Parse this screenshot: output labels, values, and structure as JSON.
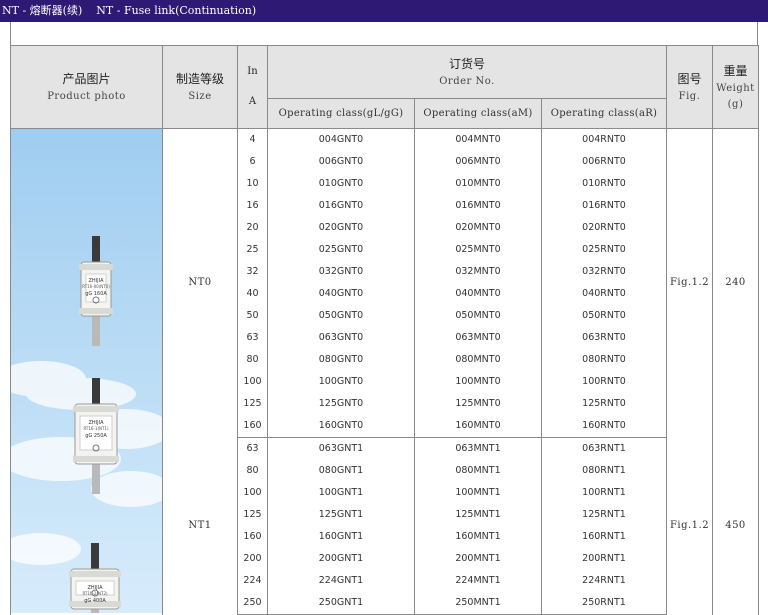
{
  "title": {
    "zh": "NT - 熔断器(续)",
    "en": "NT - Fuse link(Continuation)"
  },
  "header": {
    "photo_zh": "产品图片",
    "photo_en": "Product photo",
    "size_zh": "制造等级",
    "size_en": "Size",
    "in_top": "In",
    "in_bottom": "A",
    "order_zh": "订货号",
    "order_en": "Order No.",
    "op_gl": "Operating class(gL/gG)",
    "op_am": "Operating class(aM)",
    "op_ar": "Operating class(aR)",
    "fig_zh": "图号",
    "fig_en": "Fig.",
    "weight_zh": "重量",
    "weight_en": "Weight",
    "weight_unit": "(g)"
  },
  "groups": [
    {
      "size": "NT0",
      "fig": "Fig.1.2",
      "weight": "240",
      "rows": [
        {
          "in": "4",
          "gl": "004GNT0",
          "am": "004MNT0",
          "ar": "004RNT0"
        },
        {
          "in": "6",
          "gl": "006GNT0",
          "am": "006MNT0",
          "ar": "006RNT0"
        },
        {
          "in": "10",
          "gl": "010GNT0",
          "am": "010MNT0",
          "ar": "010RNT0"
        },
        {
          "in": "16",
          "gl": "016GNT0",
          "am": "016MNT0",
          "ar": "016RNT0"
        },
        {
          "in": "20",
          "gl": "020GNT0",
          "am": "020MNT0",
          "ar": "020RNT0"
        },
        {
          "in": "25",
          "gl": "025GNT0",
          "am": "025MNT0",
          "ar": "025RNT0"
        },
        {
          "in": "32",
          "gl": "032GNT0",
          "am": "032MNT0",
          "ar": "032RNT0"
        },
        {
          "in": "40",
          "gl": "040GNT0",
          "am": "040MNT0",
          "ar": "040RNT0"
        },
        {
          "in": "50",
          "gl": "050GNT0",
          "am": "050MNT0",
          "ar": "050RNT0"
        },
        {
          "in": "63",
          "gl": "063GNT0",
          "am": "063MNT0",
          "ar": "063RNT0"
        },
        {
          "in": "80",
          "gl": "080GNT0",
          "am": "080MNT0",
          "ar": "080RNT0"
        },
        {
          "in": "100",
          "gl": "100GNT0",
          "am": "100MNT0",
          "ar": "100RNT0"
        },
        {
          "in": "125",
          "gl": "125GNT0",
          "am": "125MNT0",
          "ar": "125RNT0"
        },
        {
          "in": "160",
          "gl": "160GNT0",
          "am": "160MNT0",
          "ar": "160RNT0"
        }
      ]
    },
    {
      "size": "NT1",
      "fig": "Fig.1.2",
      "weight": "450",
      "rows": [
        {
          "in": "63",
          "gl": "063GNT1",
          "am": "063MNT1",
          "ar": "063RNT1"
        },
        {
          "in": "80",
          "gl": "080GNT1",
          "am": "080MNT1",
          "ar": "080RNT1"
        },
        {
          "in": "100",
          "gl": "100GNT1",
          "am": "100MNT1",
          "ar": "100RNT1"
        },
        {
          "in": "125",
          "gl": "125GNT1",
          "am": "125MNT1",
          "ar": "125RNT1"
        },
        {
          "in": "160",
          "gl": "160GNT1",
          "am": "160MNT1",
          "ar": "160RNT1"
        },
        {
          "in": "200",
          "gl": "200GNT1",
          "am": "200MNT1",
          "ar": "200RNT1"
        },
        {
          "in": "224",
          "gl": "224GNT1",
          "am": "224MNT1",
          "ar": "224RNT1"
        },
        {
          "in": "250",
          "gl": "250GNT1",
          "am": "250MNT1",
          "ar": "250RNT1"
        }
      ]
    }
  ],
  "photo": {
    "sky_top": "#9fcdf0",
    "sky_bottom": "#d8ecfb",
    "fuses": [
      {
        "brand": "ZHIJIA",
        "model": "RT16-00(NT0)",
        "rating": "gG 160A"
      },
      {
        "brand": "ZHIJIA",
        "model": "RT16-1(NT1)",
        "rating": "gG 250A"
      },
      {
        "brand": "ZHIJIA",
        "model": "RT16-2(NT2)",
        "rating": "gG 400A"
      }
    ]
  }
}
